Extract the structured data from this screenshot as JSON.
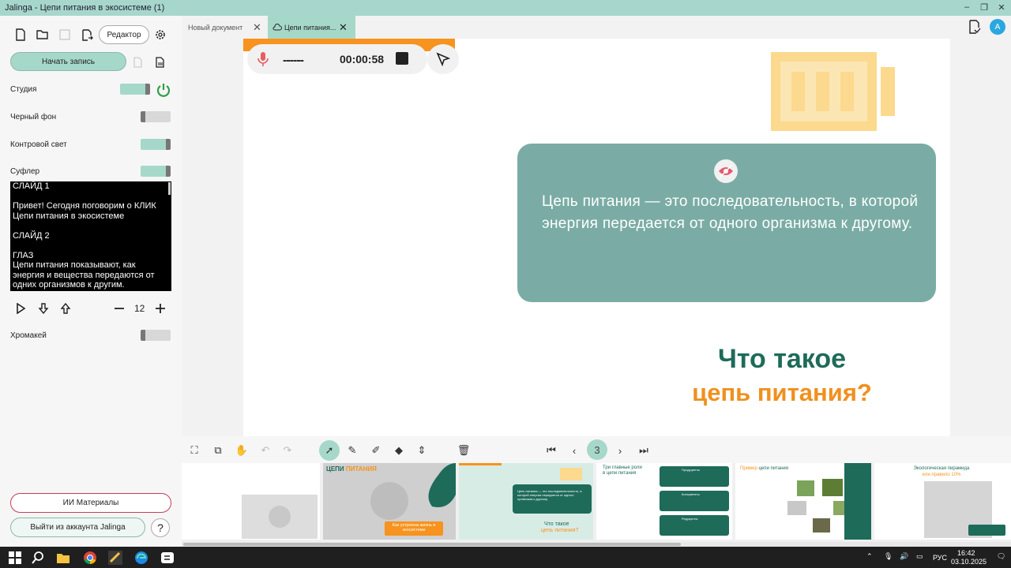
{
  "window": {
    "title": "Jalinga - Цепи питания в экосистеме (1)"
  },
  "sidebar": {
    "editor_label": "Редактор",
    "record_label": "Начать запись",
    "toggles": {
      "studio": "Студия",
      "black_bg": "Черный фон",
      "backlight": "Контровой свет",
      "prompter": "Суфлер",
      "chromakey": "Хромакей"
    },
    "prompter_lines": [
      "СЛАЙД 1",
      "",
      "Привет! Сегодня поговорим о КЛИК",
      "Цепи питания в экосистеме",
      "",
      "СЛАЙД 2",
      "",
      "ГЛАЗ",
      "Цепи питания показывают, как энергия и вещества передаются от одних организмов к другим."
    ],
    "font_size": "12",
    "ai_materials": "ИИ Материалы",
    "logout": "Выйти из аккаунта Jalinga",
    "help": "?"
  },
  "tabs": [
    {
      "label": "Новый документ",
      "active": false
    },
    {
      "label": "Цепи питания...",
      "active": true
    }
  ],
  "avatar": "А",
  "recorder": {
    "timer": "00:00:58",
    "level": "------"
  },
  "slide": {
    "card_text": "Цепь питания — это последовательность, в которой энергия передается от одного организма к другому.",
    "question_line1": "Что такое",
    "question_line2": "цепь питания?"
  },
  "toolbar": {
    "current_slide": "3"
  },
  "thumbnails": [
    {
      "title_a": "ЦЕПИ",
      "title_b": "ПИТАНИЯ",
      "button": "Как устроена жизнь в экосистеме"
    },
    {
      "text": "Цепь питания — это последовательность, в которой энергия передается от одного организма к другому.",
      "q1": "Что такое",
      "q2": "цепь питания?"
    },
    {
      "title_a": "Три главные роли",
      "title_b": "в цепи питания",
      "rows": [
        "Продуценты",
        "Консументы",
        "Редуценты"
      ]
    },
    {
      "title_a": "Пример",
      "title_b": "цепи питания"
    },
    {
      "title_a": "Экологическая пирамида",
      "title_b": "или правило 10%"
    }
  ],
  "taskbar": {
    "lang": "РУС",
    "time": "16:42",
    "date": "03.10.2025"
  },
  "colors": {
    "accent_orange": "#f7931e",
    "teal": "#7aaca5",
    "dark_green": "#1e6b5a",
    "mint": "#a6d8c9"
  }
}
